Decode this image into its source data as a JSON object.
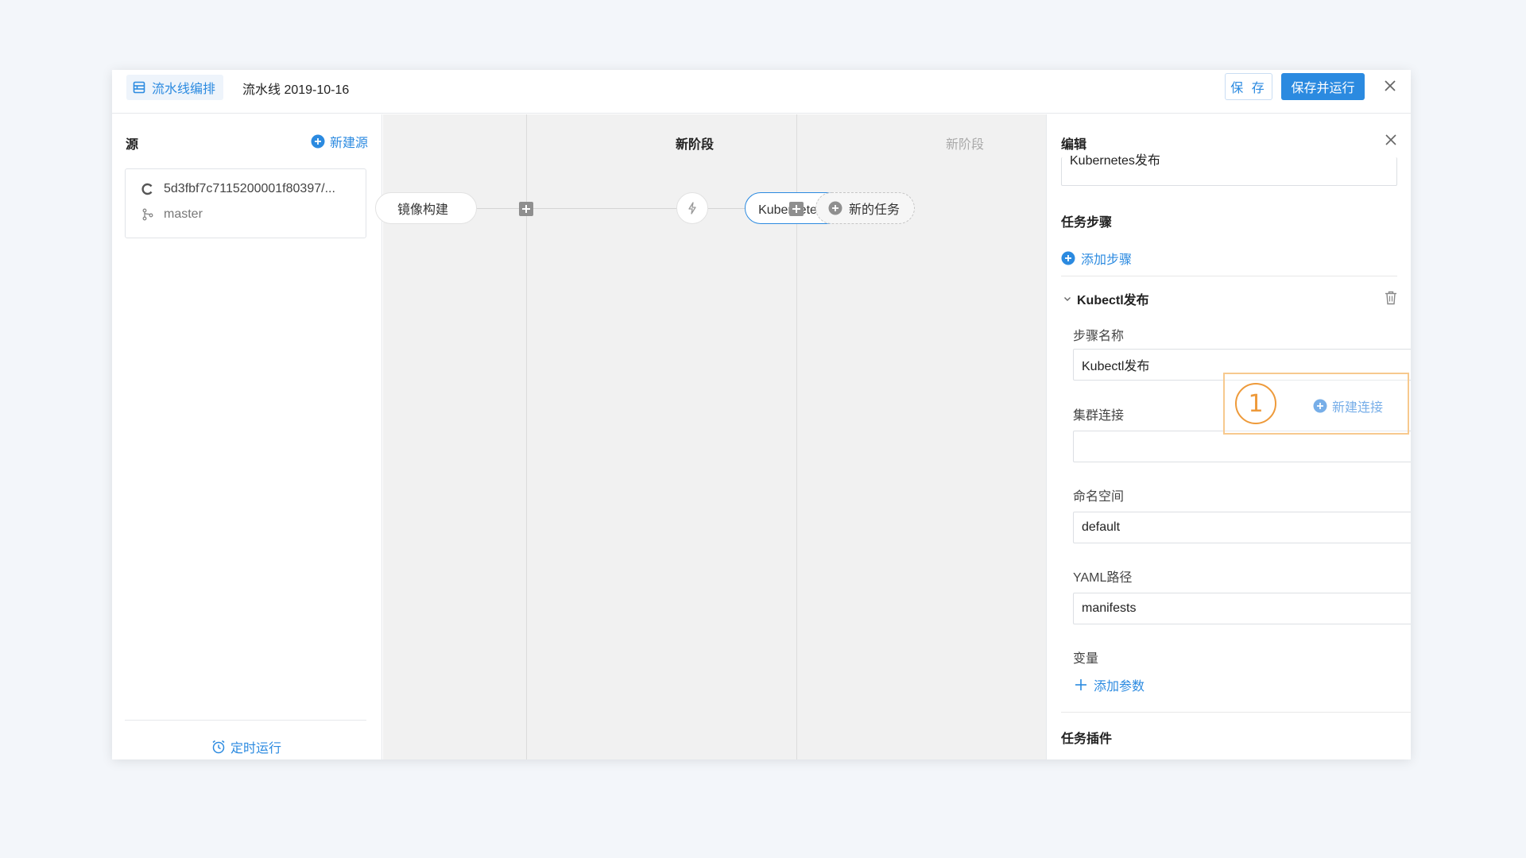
{
  "header": {
    "tag_label": "流水线编排",
    "pipeline_name": "流水线 2019-10-16",
    "save_label": "保 存",
    "save_run_label": "保存并运行"
  },
  "source": {
    "title": "源",
    "new_label": "新建源",
    "repo": "5d3fbf7c7115200001f80397/...",
    "branch": "master",
    "timer_label": "定时运行"
  },
  "canvas": {
    "build_task": "镜像构建",
    "stage_title": "新阶段",
    "deploy_task": "Kubernetes发布",
    "next_stage_title": "新阶段",
    "new_task_label": "新的任务"
  },
  "edit": {
    "title": "编辑",
    "task_name_value": "Kubernetes发布",
    "steps_title": "任务步骤",
    "add_step_label": "添加步骤",
    "step_section_title": "Kubectl发布",
    "step_name_label": "步骤名称",
    "step_name_value": "Kubectl发布",
    "cluster_label": "集群连接",
    "cluster_value": "",
    "namespace_label": "命名空间",
    "namespace_value": "default",
    "yaml_label": "YAML路径",
    "yaml_value": "manifests",
    "variables_label": "变量",
    "add_param_label": "添加参数",
    "plugins_title": "任务插件"
  },
  "annotation": {
    "badge": "1",
    "new_connection_label": "新建连接"
  },
  "colors": {
    "accent": "#2b8ae0",
    "highlight": "#ee9a3a"
  }
}
